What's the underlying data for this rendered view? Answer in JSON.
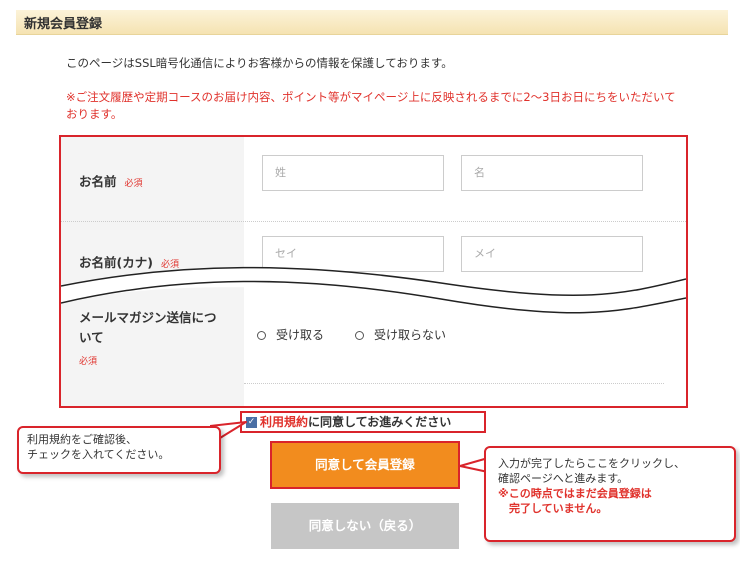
{
  "header": {
    "title": "新規会員登録"
  },
  "notice": "このページはSSL暗号化通信によりお客様からの情報を保護しております。",
  "warning": "※ご注文履歴や定期コースのお届け内容、ポイント等がマイページ上に反映されるまでに2〜3日お日にちをいただいております。",
  "form": {
    "required": "必須",
    "name": {
      "label": "お名前",
      "last_placeholder": "姓",
      "first_placeholder": "名"
    },
    "kana": {
      "label": "お名前(カナ)",
      "last_placeholder": "セイ",
      "first_placeholder": "メイ"
    },
    "magazine": {
      "label": "メールマガジン送信について",
      "options": [
        "受け取る",
        "受け取らない"
      ]
    }
  },
  "agree": {
    "checked": true,
    "link_text": "利用規約",
    "text": "に同意してお進みください"
  },
  "buttons": {
    "register": "同意して会員登録",
    "back": "同意しない（戻る）"
  },
  "callouts": {
    "left": "利用規約をご確認後、\nチェックを入れてください。",
    "right_normal": "入力が完了したらここをクリックし、\n確認ページへと進みます。",
    "right_red": "※この時点ではまだ会員登録は\n　完了していません。"
  },
  "colors": {
    "accent_red": "#d9242b",
    "button_orange": "#f28c1e",
    "button_gray": "#c6c6c6",
    "header_bg": "#f5e3b2"
  }
}
